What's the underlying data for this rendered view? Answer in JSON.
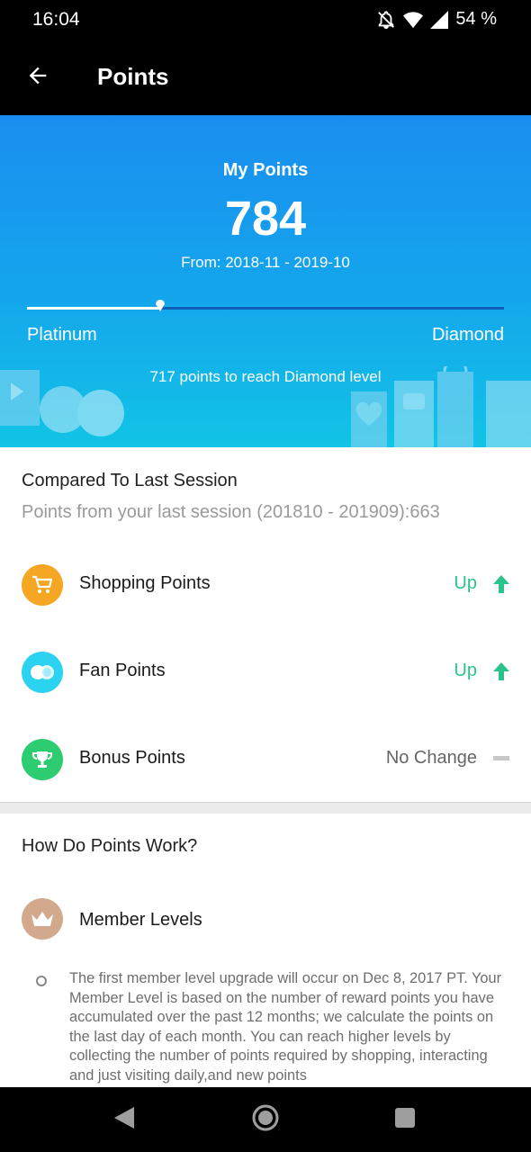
{
  "status_bar": {
    "time": "16:04",
    "battery_text": "54 %",
    "icons": [
      "bell-off-icon",
      "wifi-icon",
      "signal-icon",
      "battery-icon"
    ]
  },
  "app_bar": {
    "title": "Points",
    "back_icon": "arrow-left-icon"
  },
  "hero": {
    "label": "My Points",
    "value": "784",
    "range": "From: 2018-11 - 2019-10",
    "level_current": "Platinum",
    "level_next": "Diamond",
    "progress_fraction": 0.28,
    "note": "717 points to reach Diamond level",
    "colors": {
      "gradient_top": "#1a8ef0",
      "gradient_bottom": "#12c4e6"
    }
  },
  "compare": {
    "title": "Compared To Last Session",
    "subtitle": "Points from your last session (201810 - 201909):663",
    "rows": [
      {
        "label": "Shopping Points",
        "status": "Up",
        "trend": "up",
        "icon": "cart-icon",
        "icon_color": "#f5a623",
        "status_color": "#2ac38b"
      },
      {
        "label": "Fan Points",
        "status": "Up",
        "trend": "up",
        "icon": "fan-circles-icon",
        "icon_color": "#2cd3f1",
        "status_color": "#2ac38b"
      },
      {
        "label": "Bonus Points",
        "status": "No Change",
        "trend": "none",
        "icon": "trophy-icon",
        "icon_color": "#2ecc71",
        "status_color": "#666666"
      }
    ]
  },
  "how": {
    "title": "How Do Points Work?",
    "member_levels_label": "Member Levels",
    "member_icon": "crown-icon",
    "paragraph": "The first member level upgrade will occur on Dec 8, 2017 PT. Your Member Level is based on the number of reward points you have accumulated over the past 12 months; we calculate the points on the last day of each month.  You can reach higher levels by collecting the number of points required by shopping, interacting and just visiting daily,and new points"
  },
  "nav_bar": {
    "icons": [
      "back-triangle-icon",
      "home-circle-icon",
      "recents-square-icon"
    ]
  }
}
